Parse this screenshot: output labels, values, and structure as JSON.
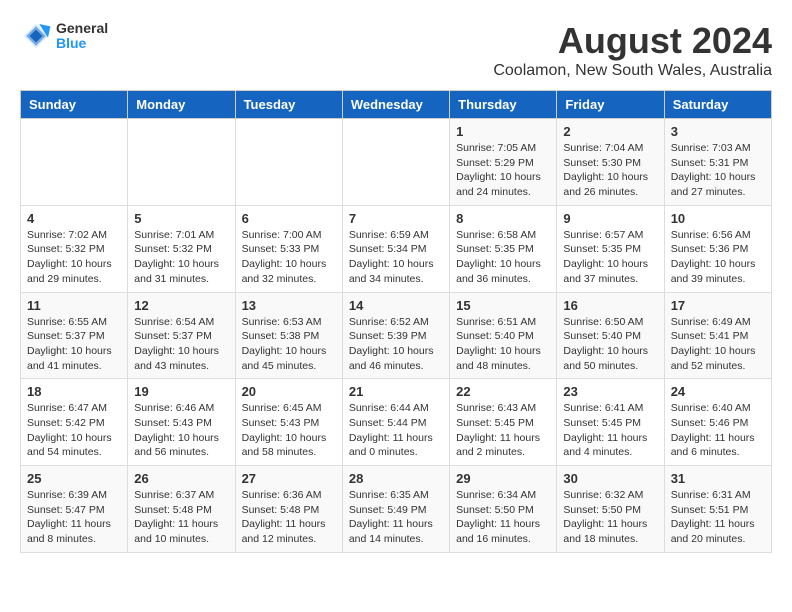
{
  "header": {
    "logo_general": "General",
    "logo_blue": "Blue",
    "title": "August 2024",
    "subtitle": "Coolamon, New South Wales, Australia"
  },
  "days_of_week": [
    "Sunday",
    "Monday",
    "Tuesday",
    "Wednesday",
    "Thursday",
    "Friday",
    "Saturday"
  ],
  "weeks": [
    [
      {
        "day": "",
        "info": ""
      },
      {
        "day": "",
        "info": ""
      },
      {
        "day": "",
        "info": ""
      },
      {
        "day": "",
        "info": ""
      },
      {
        "day": "1",
        "info": "Sunrise: 7:05 AM\nSunset: 5:29 PM\nDaylight: 10 hours\nand 24 minutes."
      },
      {
        "day": "2",
        "info": "Sunrise: 7:04 AM\nSunset: 5:30 PM\nDaylight: 10 hours\nand 26 minutes."
      },
      {
        "day": "3",
        "info": "Sunrise: 7:03 AM\nSunset: 5:31 PM\nDaylight: 10 hours\nand 27 minutes."
      }
    ],
    [
      {
        "day": "4",
        "info": "Sunrise: 7:02 AM\nSunset: 5:32 PM\nDaylight: 10 hours\nand 29 minutes."
      },
      {
        "day": "5",
        "info": "Sunrise: 7:01 AM\nSunset: 5:32 PM\nDaylight: 10 hours\nand 31 minutes."
      },
      {
        "day": "6",
        "info": "Sunrise: 7:00 AM\nSunset: 5:33 PM\nDaylight: 10 hours\nand 32 minutes."
      },
      {
        "day": "7",
        "info": "Sunrise: 6:59 AM\nSunset: 5:34 PM\nDaylight: 10 hours\nand 34 minutes."
      },
      {
        "day": "8",
        "info": "Sunrise: 6:58 AM\nSunset: 5:35 PM\nDaylight: 10 hours\nand 36 minutes."
      },
      {
        "day": "9",
        "info": "Sunrise: 6:57 AM\nSunset: 5:35 PM\nDaylight: 10 hours\nand 37 minutes."
      },
      {
        "day": "10",
        "info": "Sunrise: 6:56 AM\nSunset: 5:36 PM\nDaylight: 10 hours\nand 39 minutes."
      }
    ],
    [
      {
        "day": "11",
        "info": "Sunrise: 6:55 AM\nSunset: 5:37 PM\nDaylight: 10 hours\nand 41 minutes."
      },
      {
        "day": "12",
        "info": "Sunrise: 6:54 AM\nSunset: 5:37 PM\nDaylight: 10 hours\nand 43 minutes."
      },
      {
        "day": "13",
        "info": "Sunrise: 6:53 AM\nSunset: 5:38 PM\nDaylight: 10 hours\nand 45 minutes."
      },
      {
        "day": "14",
        "info": "Sunrise: 6:52 AM\nSunset: 5:39 PM\nDaylight: 10 hours\nand 46 minutes."
      },
      {
        "day": "15",
        "info": "Sunrise: 6:51 AM\nSunset: 5:40 PM\nDaylight: 10 hours\nand 48 minutes."
      },
      {
        "day": "16",
        "info": "Sunrise: 6:50 AM\nSunset: 5:40 PM\nDaylight: 10 hours\nand 50 minutes."
      },
      {
        "day": "17",
        "info": "Sunrise: 6:49 AM\nSunset: 5:41 PM\nDaylight: 10 hours\nand 52 minutes."
      }
    ],
    [
      {
        "day": "18",
        "info": "Sunrise: 6:47 AM\nSunset: 5:42 PM\nDaylight: 10 hours\nand 54 minutes."
      },
      {
        "day": "19",
        "info": "Sunrise: 6:46 AM\nSunset: 5:43 PM\nDaylight: 10 hours\nand 56 minutes."
      },
      {
        "day": "20",
        "info": "Sunrise: 6:45 AM\nSunset: 5:43 PM\nDaylight: 10 hours\nand 58 minutes."
      },
      {
        "day": "21",
        "info": "Sunrise: 6:44 AM\nSunset: 5:44 PM\nDaylight: 11 hours\nand 0 minutes."
      },
      {
        "day": "22",
        "info": "Sunrise: 6:43 AM\nSunset: 5:45 PM\nDaylight: 11 hours\nand 2 minutes."
      },
      {
        "day": "23",
        "info": "Sunrise: 6:41 AM\nSunset: 5:45 PM\nDaylight: 11 hours\nand 4 minutes."
      },
      {
        "day": "24",
        "info": "Sunrise: 6:40 AM\nSunset: 5:46 PM\nDaylight: 11 hours\nand 6 minutes."
      }
    ],
    [
      {
        "day": "25",
        "info": "Sunrise: 6:39 AM\nSunset: 5:47 PM\nDaylight: 11 hours\nand 8 minutes."
      },
      {
        "day": "26",
        "info": "Sunrise: 6:37 AM\nSunset: 5:48 PM\nDaylight: 11 hours\nand 10 minutes."
      },
      {
        "day": "27",
        "info": "Sunrise: 6:36 AM\nSunset: 5:48 PM\nDaylight: 11 hours\nand 12 minutes."
      },
      {
        "day": "28",
        "info": "Sunrise: 6:35 AM\nSunset: 5:49 PM\nDaylight: 11 hours\nand 14 minutes."
      },
      {
        "day": "29",
        "info": "Sunrise: 6:34 AM\nSunset: 5:50 PM\nDaylight: 11 hours\nand 16 minutes."
      },
      {
        "day": "30",
        "info": "Sunrise: 6:32 AM\nSunset: 5:50 PM\nDaylight: 11 hours\nand 18 minutes."
      },
      {
        "day": "31",
        "info": "Sunrise: 6:31 AM\nSunset: 5:51 PM\nDaylight: 11 hours\nand 20 minutes."
      }
    ]
  ]
}
